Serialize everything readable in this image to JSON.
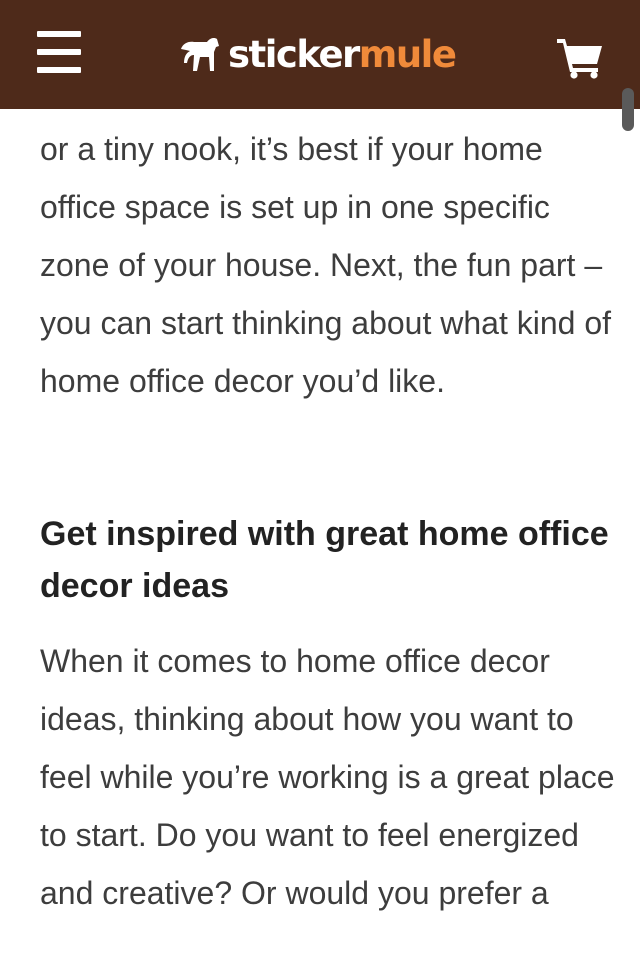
{
  "header": {
    "logo_part1": "sticker",
    "logo_part2": "mule",
    "background_color": "#4e2a1a",
    "accent_color": "#f08a3a",
    "icons": [
      "menu-icon",
      "horse-logo-icon",
      "cart-icon"
    ]
  },
  "article": {
    "paragraph_1": "Whether you have a whole entire room or a tiny nook, it’s best if your home office space is set up in one specific zone of your house. Next, the fun part – you can start thinking about what kind of home office decor you’d like.",
    "heading": "Get inspired with great home office decor ideas",
    "paragraph_2": "When it comes to home office decor ideas, thinking about how you want to feel while you’re working is a great place to start. Do you want to feel energized and creative? Or would you prefer a"
  }
}
